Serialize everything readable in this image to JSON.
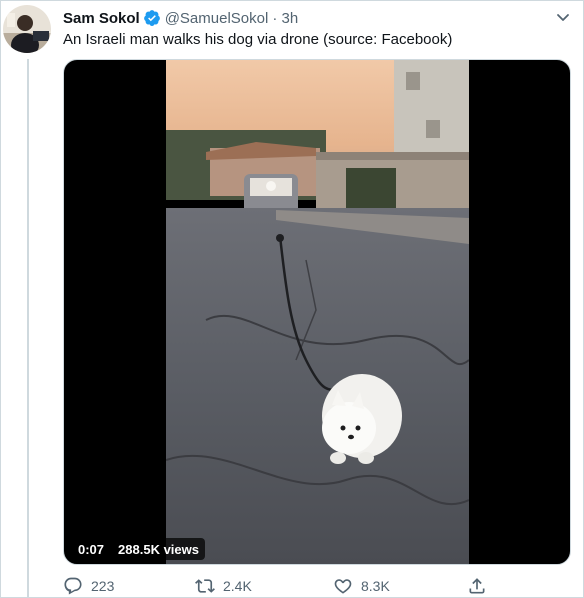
{
  "tweet": {
    "author_name": "Sam Sokol",
    "author_handle": "@SamuelSokol",
    "timestamp": "· 3h",
    "text": "An Israeli man walks his dog via drone (source: Facebook)",
    "verified": true
  },
  "video": {
    "time": "0:07",
    "views": "288.5K views"
  },
  "actions": {
    "replies": "223",
    "retweets": "2.4K",
    "likes": "8.3K"
  },
  "colors": {
    "verified_blue": "#1d9bf0",
    "muted_text": "#536471",
    "border": "#cfd9de"
  },
  "icons": [
    "verified-badge-icon",
    "chevron-down-icon",
    "reply-icon",
    "retweet-icon",
    "like-icon",
    "share-icon"
  ]
}
